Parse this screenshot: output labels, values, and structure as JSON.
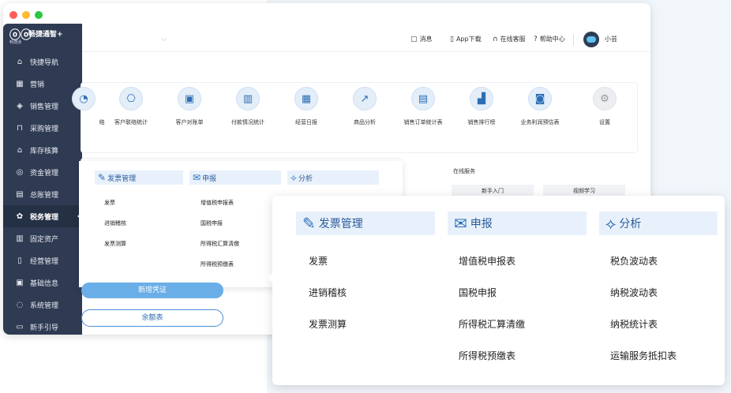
{
  "sidebar": {
    "logo_name": "畅捷通智+",
    "logo_sub": "畅捷通",
    "items": [
      {
        "label": "快捷导航",
        "icon": "home-icon"
      },
      {
        "label": "营销",
        "icon": "calendar-icon"
      },
      {
        "label": "销售管理",
        "icon": "sales-icon"
      },
      {
        "label": "采购管理",
        "icon": "bag-icon"
      },
      {
        "label": "库存核算",
        "icon": "warehouse-icon"
      },
      {
        "label": "资金管理",
        "icon": "money-icon"
      },
      {
        "label": "总账管理",
        "icon": "ledger-icon"
      },
      {
        "label": "税务管理",
        "icon": "tax-icon"
      },
      {
        "label": "固定资产",
        "icon": "asset-icon"
      },
      {
        "label": "经营管理",
        "icon": "business-icon"
      },
      {
        "label": "基础信息",
        "icon": "info-icon"
      },
      {
        "label": "系统管理",
        "icon": "system-icon"
      },
      {
        "label": "新手引导",
        "icon": "guide-icon"
      }
    ]
  },
  "topbar": {
    "messages": "消息",
    "app_download": "App下载",
    "online_service": "在线客服",
    "help_center": "帮助中心",
    "user_name": "小芸"
  },
  "quick_access": [
    {
      "label": "络",
      "icon": "chart-icon"
    },
    {
      "label": "客户联络统计",
      "icon": "contact-stats-icon"
    },
    {
      "label": "客户对账单",
      "icon": "statement-icon"
    },
    {
      "label": "付款情况统计",
      "icon": "payment-stats-icon"
    },
    {
      "label": "经营日报",
      "icon": "daily-report-icon"
    },
    {
      "label": "商品分析",
      "icon": "product-analysis-icon"
    },
    {
      "label": "销售订单统计表",
      "icon": "sales-order-icon"
    },
    {
      "label": "销售排行榜",
      "icon": "ranking-icon"
    },
    {
      "label": "业务利润预估表",
      "icon": "profit-icon"
    },
    {
      "label": "设置",
      "icon": "gear-icon"
    }
  ],
  "small_menu": {
    "invoice_header": "发票管理",
    "declare_header": "申报",
    "analysis_header": "分析",
    "invoice_items": [
      "发票",
      "进销稽核",
      "发票测算"
    ],
    "declare_items": [
      "增值税申报表",
      "国税申报",
      "所得税汇算清缴",
      "所得税预缴表"
    ]
  },
  "online_service_card": {
    "title": "在线服务",
    "btn1": "新手入门",
    "btn2": "视频学习"
  },
  "buttons": {
    "new_voucher": "新增凭证",
    "balance": "余额表"
  },
  "big_menu": {
    "invoice_header": "发票管理",
    "declare_header": "申报",
    "analysis_header": "分析",
    "invoice_items": [
      "发票",
      "进销稽核",
      "发票测算"
    ],
    "declare_items": [
      "增值税申报表",
      "国税申报",
      "所得税汇算清缴",
      "所得税预缴表"
    ],
    "analysis_items": [
      "税负波动表",
      "纳税波动表",
      "纳税统计表",
      "运输服务抵扣表"
    ]
  }
}
